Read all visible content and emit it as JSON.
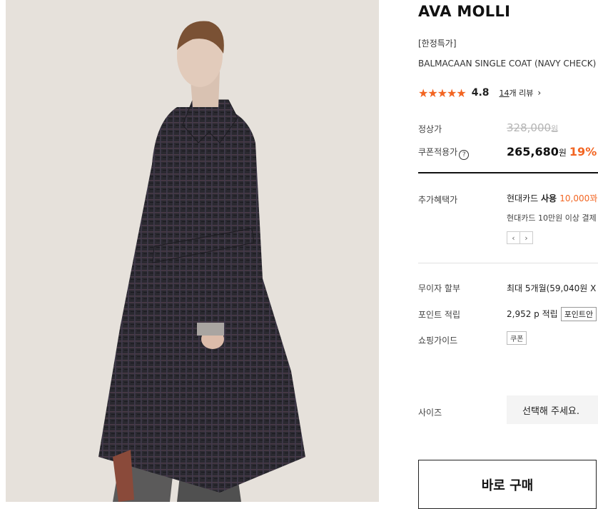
{
  "product": {
    "brand": "AVA MOLLI",
    "tag": "[한정특가]",
    "name": "BALMACAAN SINGLE COAT (NAVY CHECK)",
    "image_alt": "model wearing navy check wool coat"
  },
  "rating": {
    "stars": "★★★★★",
    "score": "4.8",
    "review_count": "14",
    "review_suffix": "개 리뷰",
    "arrow": "›"
  },
  "price": {
    "regular_label": "정상가",
    "regular_value": "328,000",
    "regular_unit": "원",
    "coupon_label": "쿠폰적용가",
    "coupon_help_icon": "?",
    "sale_value": "265,680",
    "sale_unit": "원",
    "discount": "19%"
  },
  "benefits": {
    "label": "추가혜택가",
    "card_prefix": "현대카드 ",
    "card_use": "사용 ",
    "card_amount": "10,000꽈",
    "card_note": "현대카드 10만원 이상 결제",
    "prev": "‹",
    "next": "›"
  },
  "installment": {
    "label": "무이자 할부",
    "value": "최대 5개월(59,040원 X"
  },
  "points": {
    "label": "포인트 적립",
    "value": "2,952 p 적립",
    "pill": "포인트안"
  },
  "shopping_guide": {
    "label": "쇼핑가이드",
    "tag": "쿠폰"
  },
  "size": {
    "label": "사이즈",
    "placeholder": "선택해 주세요."
  },
  "buy_now": "바로 구매",
  "colors": {
    "accent": "#f26522",
    "coat": "#2b2a30",
    "background": "#e6e1db"
  }
}
